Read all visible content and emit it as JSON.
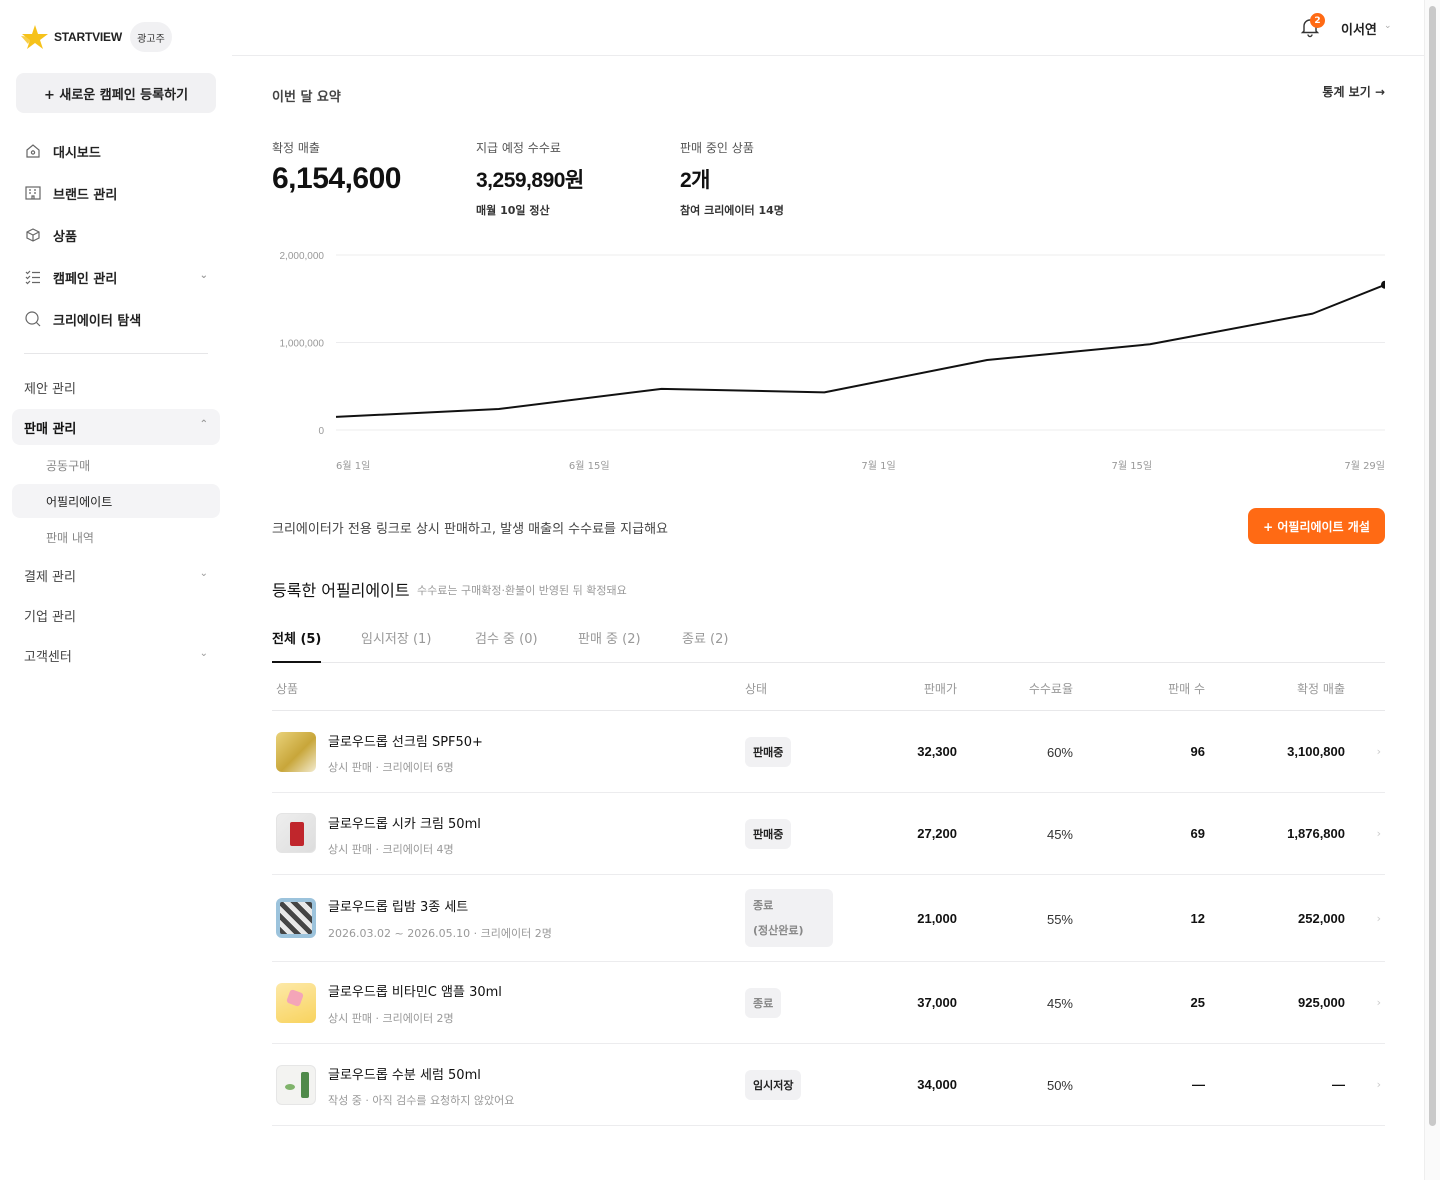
{
  "brand": {
    "logo_text": "STARTVIEW",
    "role_badge": "광고주",
    "accent": "#ff6a14"
  },
  "sidebar": {
    "new_campaign": "+ 새로운 캠페인 등록하기",
    "main_items": [
      {
        "label": "대시보드",
        "icon": "home-icon"
      },
      {
        "label": "브랜드 관리",
        "icon": "building-icon"
      },
      {
        "label": "상품",
        "icon": "box-icon"
      },
      {
        "label": "캠페인 관리",
        "icon": "checklist-icon"
      },
      {
        "label": "크리에이터 탐색",
        "icon": "search-icon"
      }
    ],
    "sections": {
      "proposals": "제안 관리",
      "sales": "판매 관리",
      "sales_sub": [
        "공동구매",
        "어필리에이트",
        "판매 내역"
      ],
      "payments": "결제 관리",
      "company": "기업 관리",
      "support": "고객센터"
    }
  },
  "topbar": {
    "notification_count": "2",
    "user_name": "이서연"
  },
  "summary": {
    "title": "이번 달 요약",
    "stats_link": "통계 보기 →",
    "kpis": [
      {
        "label": "확정 매출",
        "value": "6,154,600",
        "sub": ""
      },
      {
        "label": "지급 예정 수수료",
        "value": "3,259,890원",
        "sub": "매월 10일 정산"
      },
      {
        "label": "판매 중인 상품",
        "value": "2개",
        "sub": "참여 크리에이터 14명"
      }
    ]
  },
  "chart_data": {
    "type": "line",
    "ylim": [
      0,
      2000000
    ],
    "y_ticks": [
      "2,000,000",
      "1,000,000",
      "0"
    ],
    "x_tick_labels": [
      "6월 1일",
      "6월 15일",
      "7월 1일",
      "7월 15일",
      "7월 29일"
    ],
    "x_days": [
      0,
      14,
      30,
      44,
      58
    ],
    "series": [
      {
        "x": [
          0,
          9,
          18,
          27,
          36,
          45,
          54,
          58
        ],
        "values": [
          150000,
          240000,
          470000,
          430000,
          800000,
          980000,
          1330000,
          1660000
        ]
      }
    ]
  },
  "affiliate": {
    "description": "크리에이터가 전용 링크로 상시 판매하고, 발생 매출의 수수료를 지급해요",
    "open_button": "+ 어필리에이트 개설",
    "list_title": "등록한 어필리에이트",
    "list_hint": "수수료는 구매확정·환불이 반영된 뒤 확정돼요",
    "tabs": [
      "전체 (5)",
      "임시저장 (1)",
      "검수 중 (0)",
      "판매 중 (2)",
      "종료 (2)"
    ],
    "columns": [
      "상품",
      "상태",
      "판매가",
      "수수료율",
      "판매 수",
      "확정 매출"
    ],
    "rows": [
      {
        "name": "글로우드롭 선크림 SPF50+",
        "meta": "상시 판매 · 크리에이터 6명",
        "status": "판매중",
        "price": "32,300",
        "rate": "60%",
        "count": "96",
        "revenue": "3,100,800"
      },
      {
        "name": "글로우드롭 시카 크림 50ml",
        "meta": "상시 판매 · 크리에이터 4명",
        "status": "판매중",
        "price": "27,200",
        "rate": "45%",
        "count": "69",
        "revenue": "1,876,800"
      },
      {
        "name": "글로우드롭 립밤 3종 세트",
        "meta": "2026.03.02 ~ 2026.05.10 · 크리에이터 2명",
        "status": "종료",
        "status2": "(정산완료)",
        "price": "21,000",
        "rate": "55%",
        "count": "12",
        "revenue": "252,000"
      },
      {
        "name": "글로우드롭 비타민C 앰플 30ml",
        "meta": "상시 판매 · 크리에이터 2명",
        "status": "종료",
        "price": "37,000",
        "rate": "45%",
        "count": "25",
        "revenue": "925,000"
      },
      {
        "name": "글로우드롭 수분 세럼 50ml",
        "meta": "작성 중 · 아직 검수를 요청하지 않았어요",
        "status": "임시저장",
        "price": "34,000",
        "rate": "50%",
        "count": "—",
        "revenue": "—"
      }
    ]
  }
}
